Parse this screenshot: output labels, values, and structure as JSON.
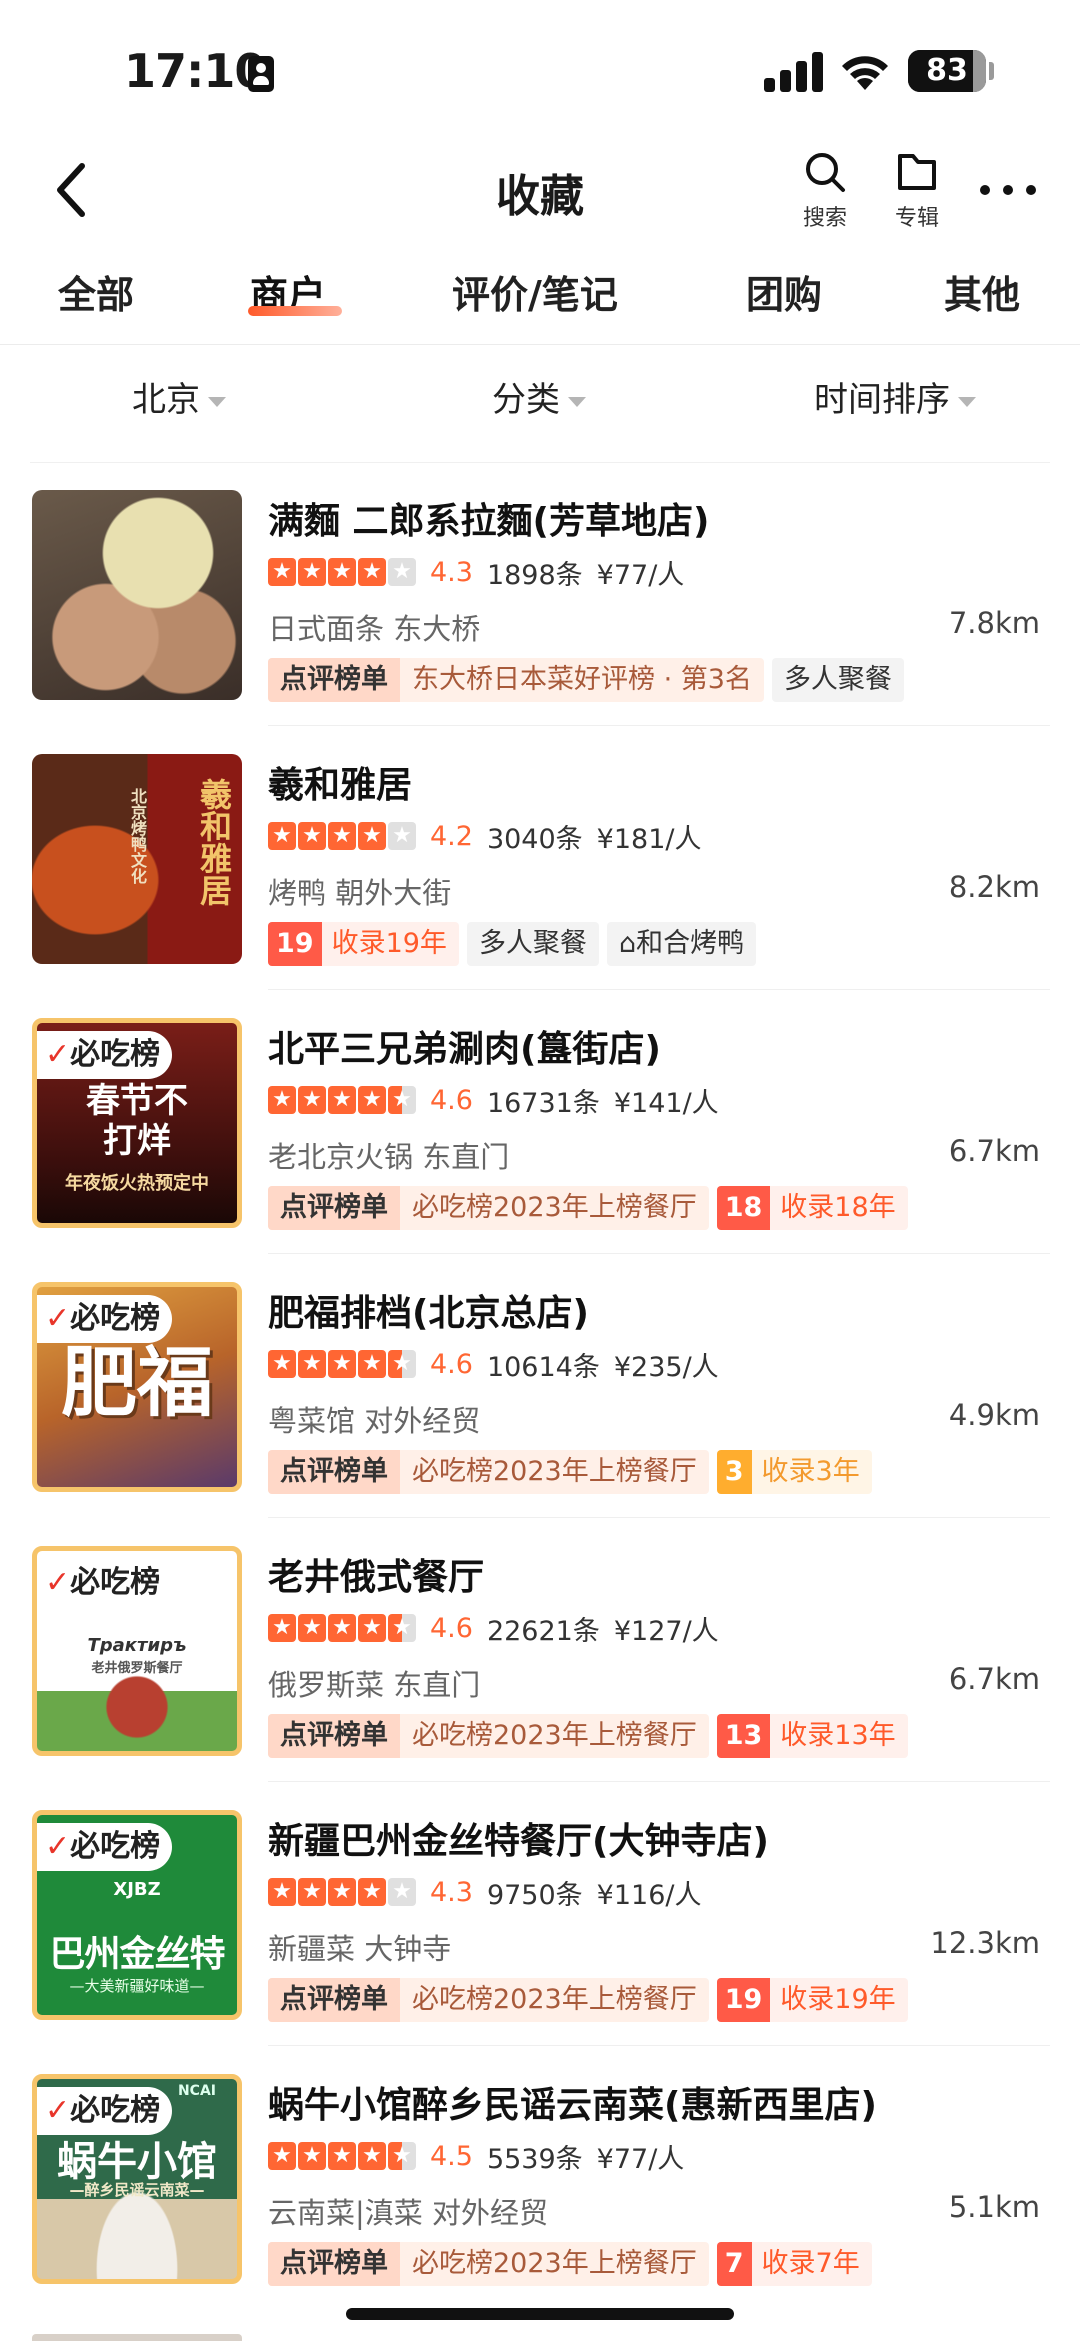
{
  "status_bar": {
    "time": "17:10",
    "battery": "83",
    "battery_level": 0.83
  },
  "header": {
    "title": "收藏",
    "search_label": "搜索",
    "album_label": "专辑"
  },
  "tabs": [
    {
      "label": "全部"
    },
    {
      "label": "商户"
    },
    {
      "label": "评价/笔记"
    },
    {
      "label": "团购"
    },
    {
      "label": "其他"
    }
  ],
  "filters": {
    "city": "北京",
    "category": "分类",
    "sort": "时间排序"
  },
  "restaurants": [
    {
      "name": "满麵 二郎系拉麵(芳草地店)",
      "score": "4.3",
      "stars": 4.0,
      "reviews": "1898条",
      "price": "¥77/人",
      "category": "日式面条 东大桥",
      "distance": "7.8km",
      "rank_badge": "点评榜单",
      "rank_text": "东大桥日本菜好评榜 · 第3名",
      "extra_tag": "多人聚餐"
    },
    {
      "name": "羲和雅居",
      "score": "4.2",
      "stars": 4.0,
      "reviews": "3040条",
      "price": "¥181/人",
      "category": "烤鸭 朝外大街",
      "distance": "8.2km",
      "years_num": "19",
      "years_text": "收录19年",
      "extra_tag": "多人聚餐",
      "extra_tag2": "和合烤鸭",
      "thumb_text": "羲和雅居",
      "thumb_text2": "北京烤鸭文化"
    },
    {
      "name": "北平三兄弟涮肉(簋街店)",
      "score": "4.6",
      "stars": 4.5,
      "reviews": "16731条",
      "price": "¥141/人",
      "category": "老北京火锅 东直门",
      "distance": "6.7km",
      "rank_badge": "点评榜单",
      "rank_text": "必吃榜2023年上榜餐厅",
      "years_num": "18",
      "years_text": "收录18年",
      "badge": "必吃榜",
      "thumb_text": "春节不打烊",
      "thumb_text2": "年夜饭火热预定中"
    },
    {
      "name": "肥福排档(北京总店)",
      "score": "4.6",
      "stars": 4.5,
      "reviews": "10614条",
      "price": "¥235/人",
      "category": "粤菜馆 对外经贸",
      "distance": "4.9km",
      "rank_badge": "点评榜单",
      "rank_text": "必吃榜2023年上榜餐厅",
      "years_num": "3",
      "years_text": "收录3年",
      "badge": "必吃榜",
      "thumb_text": "肥福"
    },
    {
      "name": "老井俄式餐厅",
      "score": "4.6",
      "stars": 4.5,
      "reviews": "22621条",
      "price": "¥127/人",
      "category": "俄罗斯菜 东直门",
      "distance": "6.7km",
      "rank_badge": "点评榜单",
      "rank_text": "必吃榜2023年上榜餐厅",
      "years_num": "13",
      "years_text": "收录13年",
      "badge": "必吃榜",
      "thumb_text": "Трактиръ",
      "thumb_text2": "老井俄罗斯餐厅"
    },
    {
      "name": "新疆巴州金丝特餐厅(大钟寺店)",
      "score": "4.3",
      "stars": 4.0,
      "reviews": "9750条",
      "price": "¥116/人",
      "category": "新疆菜 大钟寺",
      "distance": "12.3km",
      "rank_badge": "点评榜单",
      "rank_text": "必吃榜2023年上榜餐厅",
      "years_num": "19",
      "years_text": "收录19年",
      "badge": "必吃榜",
      "thumb_text": "XJBZ",
      "thumb_text2": "巴州金丝特",
      "thumb_text3": "—大美新疆好味道—"
    },
    {
      "name": "蜗牛小馆醉乡民谣云南菜(惠新西里店)",
      "score": "4.5",
      "stars": 4.5,
      "reviews": "5539条",
      "price": "¥77/人",
      "category": "云南菜|滇菜 对外经贸",
      "distance": "5.1km",
      "rank_badge": "点评榜单",
      "rank_text": "必吃榜2023年上榜餐厅",
      "years_num": "7",
      "years_text": "收录7年",
      "badge": "必吃榜",
      "thumb_text": "蜗牛小馆",
      "thumb_text2": "—醉乡民谣云南菜—",
      "thumb_text3": "NCAI"
    }
  ],
  "colors": {
    "accent": "#ff5a2a",
    "star": "#ff6633",
    "brand_green": "#1f8a3a"
  }
}
